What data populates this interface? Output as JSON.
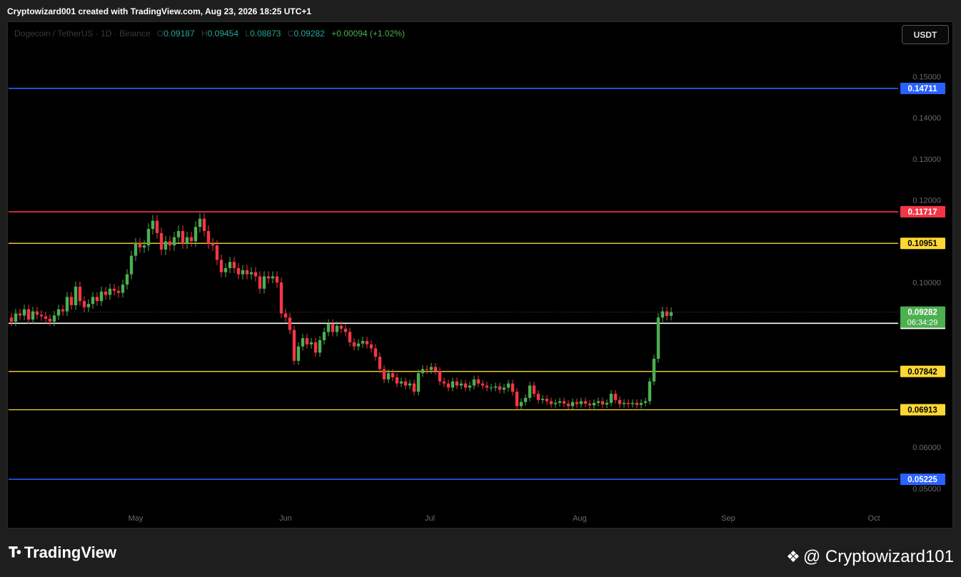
{
  "header": {
    "attribution": "Cryptowizard001 created with TradingView.com, Aug 23, 2026 18:25 UTC+1"
  },
  "legend": {
    "symbol": "Dogecoin / TetherUS · 1D · Binance",
    "open": "0.09187",
    "high": "0.09454",
    "low": "0.08873",
    "close": "0.09282",
    "change": "+0.00094 (+1.02%)"
  },
  "currency_button": "USDT",
  "footer": {
    "brand": "TradingView",
    "handle": "@ Cryptowizard101"
  },
  "chart_data": {
    "type": "candlestick",
    "y_axis": {
      "range": [
        0.0455,
        0.1632
      ],
      "ticks": [
        "0.15000",
        "0.14000",
        "0.13000",
        "0.12000",
        "0.10000",
        "0.06000",
        "0.05000"
      ]
    },
    "x_axis": {
      "labels": [
        "May",
        "Jun",
        "Jul",
        "Aug",
        "Sep",
        "Oct"
      ]
    },
    "horizontal_levels": [
      {
        "value": 0.14711,
        "label": "0.14711",
        "color": "#2962ff",
        "text_color": "#ffffff"
      },
      {
        "value": 0.11717,
        "label": "0.11717",
        "color": "#f23645",
        "text_color": "#ffffff"
      },
      {
        "value": 0.10951,
        "label": "0.10951",
        "color": "#fdd835",
        "text_color": "#000000"
      },
      {
        "value": 0.0901,
        "label": "0.09010",
        "color": "#ffffff",
        "text_color": "#000000"
      },
      {
        "value": 0.07842,
        "label": "0.07842",
        "color": "#fdd835",
        "text_color": "#000000"
      },
      {
        "value": 0.06913,
        "label": "0.06913",
        "color": "#fdd835",
        "text_color": "#000000"
      },
      {
        "value": 0.05225,
        "label": "0.05225",
        "color": "#2962ff",
        "text_color": "#ffffff"
      }
    ],
    "last_price": {
      "value": 0.09282,
      "label": "0.09282",
      "countdown": "06:34:29",
      "color": "#4caf50"
    },
    "up_color": "#4caf50",
    "down_color": "#f23645",
    "closes": [
      0.0905,
      0.0925,
      0.092,
      0.0935,
      0.091,
      0.093,
      0.0922,
      0.0918,
      0.0912,
      0.0905,
      0.092,
      0.0935,
      0.093,
      0.0965,
      0.0945,
      0.099,
      0.0955,
      0.094,
      0.0948,
      0.0965,
      0.0955,
      0.0978,
      0.097,
      0.0985,
      0.098,
      0.0975,
      0.0995,
      0.102,
      0.1065,
      0.1095,
      0.1085,
      0.109,
      0.113,
      0.115,
      0.112,
      0.108,
      0.11,
      0.109,
      0.111,
      0.1125,
      0.1095,
      0.111,
      0.11,
      0.1135,
      0.1155,
      0.1125,
      0.1095,
      0.109,
      0.1055,
      0.1025,
      0.1035,
      0.105,
      0.1035,
      0.102,
      0.103,
      0.102,
      0.1025,
      0.1015,
      0.0985,
      0.1015,
      0.101,
      0.1015,
      0.1,
      0.0925,
      0.0915,
      0.0885,
      0.081,
      0.0845,
      0.0865,
      0.085,
      0.0855,
      0.083,
      0.086,
      0.088,
      0.09,
      0.088,
      0.0895,
      0.0888,
      0.088,
      0.0855,
      0.0845,
      0.0852,
      0.0858,
      0.085,
      0.084,
      0.082,
      0.079,
      0.0765,
      0.078,
      0.077,
      0.0755,
      0.076,
      0.075,
      0.0755,
      0.0735,
      0.078,
      0.079,
      0.0788,
      0.0795,
      0.0785,
      0.076,
      0.0755,
      0.0745,
      0.076,
      0.075,
      0.0755,
      0.0745,
      0.075,
      0.0765,
      0.0755,
      0.075,
      0.0745,
      0.0745,
      0.0748,
      0.074,
      0.0745,
      0.0755,
      0.0735,
      0.07,
      0.071,
      0.072,
      0.075,
      0.073,
      0.0715,
      0.0718,
      0.0712,
      0.0705,
      0.0708,
      0.0712,
      0.0706,
      0.07,
      0.071,
      0.0705,
      0.0712,
      0.0706,
      0.0702,
      0.0708,
      0.0712,
      0.0704,
      0.0708,
      0.073,
      0.0715,
      0.0705,
      0.0708,
      0.0705,
      0.0708,
      0.0703,
      0.0708,
      0.0712,
      0.076,
      0.0815,
      0.0915,
      0.093,
      0.0919,
      0.0928
    ]
  }
}
